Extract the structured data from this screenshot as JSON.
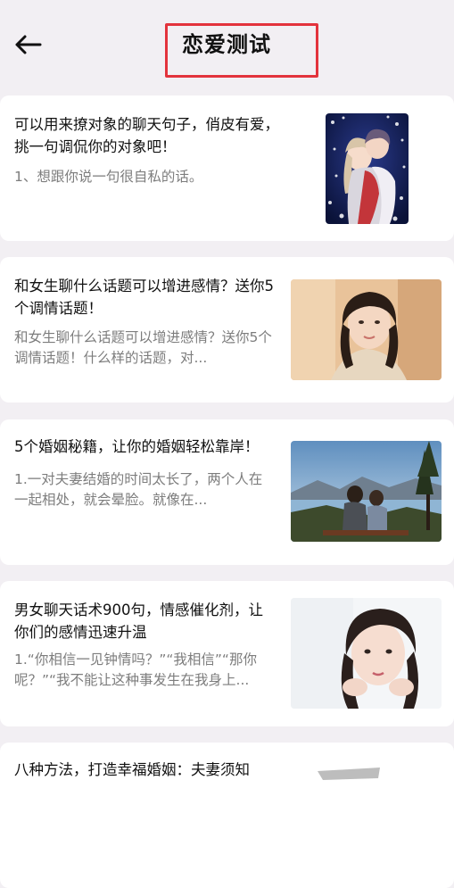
{
  "header": {
    "title": "恋爱测试",
    "back_icon": "arrow-left-icon",
    "highlight_color": "#e3333c"
  },
  "articles": [
    {
      "title": "可以用来撩对象的聊天句子，俏皮有爱，挑一句调侃你的对象吧！",
      "desc": "1、想跟你说一句很自私的话。",
      "image": "anime-couple-illustration"
    },
    {
      "title": "和女生聊什么话题可以增进感情？送你5个调情话题！",
      "desc": "和女生聊什么话题可以增进感情？送你5个调情话题！什么样的话题，对...",
      "image": "girl-portrait-sweater"
    },
    {
      "title": "5个婚姻秘籍，让你的婚姻轻松靠岸！",
      "desc": "1.一对夫妻结婚的时间太长了，两个人在一起相处，就会晕脸。就像在...",
      "image": "couple-on-mountain-bench"
    },
    {
      "title": "男女聊天话术900句，情感催化剂，让你们的感情迅速升温",
      "desc": "1.“你相信一见钟情吗？”“我相信”“那你呢？”“我不能让这种事发生在我身上...",
      "image": "girl-portrait-hands-on-face"
    },
    {
      "title": "八种方法，打造幸福婚姻：夫妻须知",
      "desc": "",
      "image": "partial-thumbnail"
    }
  ]
}
